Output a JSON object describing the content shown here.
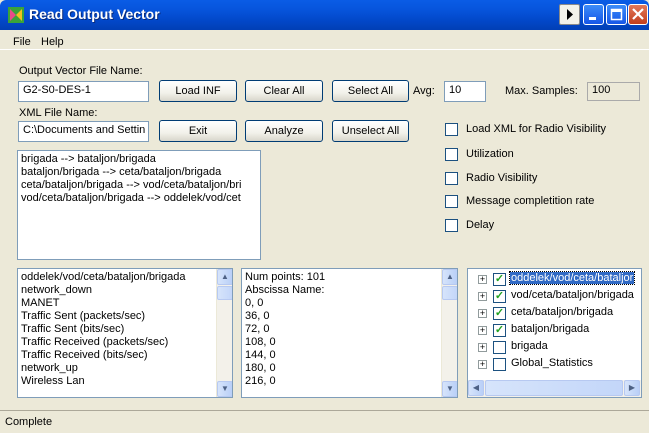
{
  "window": {
    "title": "Read Output Vector"
  },
  "menu": {
    "file": "File",
    "help": "Help"
  },
  "output_vector": {
    "label": "Output Vector File Name:",
    "value": "G2-S0-DES-1",
    "load_inf": "Load INF",
    "clear_all": "Clear All",
    "select_all": "Select All",
    "avg_label": "Avg:",
    "avg_value": "10",
    "max_samples_label": "Max. Samples:",
    "max_samples_value": "100"
  },
  "xml": {
    "label": "XML File Name:",
    "value": "C:\\Documents and Settin",
    "exit": "Exit",
    "analyze": "Analyze",
    "unselect_all": "Unselect All"
  },
  "options": [
    "Load XML for Radio Visibility",
    "Utilization",
    "Radio Visibility",
    "Message completition rate",
    "Delay"
  ],
  "paths": [
    "brigada --> bataljon/brigada",
    "bataljon/brigada --> ceta/bataljon/brigada",
    "ceta/bataljon/brigada --> vod/ceta/bataljon/bri",
    "vod/ceta/bataljon/brigada --> oddelek/vod/cet"
  ],
  "stats": [
    "oddelek/vod/ceta/bataljon/brigada",
    "network_down",
    "MANET",
    "Traffic Sent (packets/sec)",
    "Traffic Sent (bits/sec)",
    "Traffic Received (packets/sec)",
    "Traffic Received (bits/sec)",
    "network_up",
    "Wireless Lan"
  ],
  "points": [
    "Num points: 101",
    "Abscissa Name:",
    "0, 0",
    "36, 0",
    "72, 0",
    "108, 0",
    "144, 0",
    "180, 0",
    "216, 0"
  ],
  "tree": [
    {
      "label": "oddelek/vod/ceta/bataljor",
      "checked": "✓",
      "selected": true
    },
    {
      "label": "vod/ceta/bataljon/brigada",
      "checked": "✓",
      "selected": false
    },
    {
      "label": "ceta/bataljon/brigada",
      "checked": "✓",
      "selected": false
    },
    {
      "label": "bataljon/brigada",
      "checked": "✓",
      "selected": false
    },
    {
      "label": "brigada",
      "checked": "",
      "selected": false
    },
    {
      "label": "Global_Statistics",
      "checked": "",
      "selected": false
    }
  ],
  "tree_expander": "+",
  "status": {
    "text": "Complete"
  },
  "icons": {
    "app": "app-icon",
    "play": "play-icon",
    "minimize": "minimize-icon",
    "maximize": "maximize-icon",
    "close": "close-icon"
  },
  "colors": {
    "titlebar": "#0247c8",
    "window": "#ece9d8",
    "selection": "#316ac5",
    "close": "#c13d1c"
  }
}
